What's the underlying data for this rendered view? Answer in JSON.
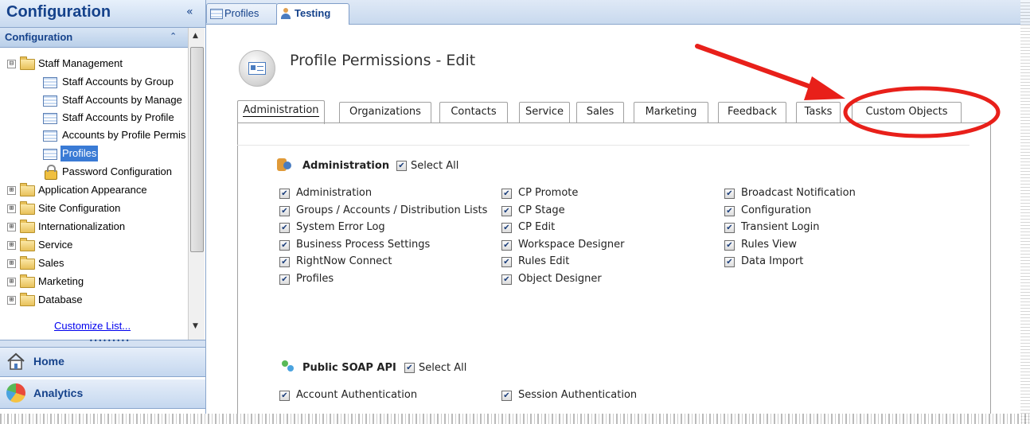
{
  "nav": {
    "pane_title": "Configuration",
    "collapse_glyph": "«",
    "section_label": "Configuration",
    "section_chevron": "⌃",
    "tree": [
      {
        "label": "Staff Management",
        "type": "folder",
        "expander": "⊟"
      },
      {
        "label": "Staff Accounts by Group",
        "type": "report"
      },
      {
        "label": "Staff Accounts by Manage",
        "type": "report"
      },
      {
        "label": "Staff Accounts by Profile",
        "type": "report"
      },
      {
        "label": "Accounts by Profile Permis",
        "type": "report"
      },
      {
        "label": "Profiles",
        "type": "report",
        "selected": true
      },
      {
        "label": "Password Configuration",
        "type": "lock"
      },
      {
        "label": "Application Appearance",
        "type": "folder",
        "expander": "⊞"
      },
      {
        "label": "Site Configuration",
        "type": "folder",
        "expander": "⊞"
      },
      {
        "label": "Internationalization",
        "type": "folder",
        "expander": "⊞"
      },
      {
        "label": "Service",
        "type": "folder",
        "expander": "⊞"
      },
      {
        "label": "Sales",
        "type": "folder",
        "expander": "⊞"
      },
      {
        "label": "Marketing",
        "type": "folder",
        "expander": "⊞"
      },
      {
        "label": "Database",
        "type": "folder",
        "expander": "⊞"
      }
    ],
    "customize_link": "Customize List...",
    "splitter_dots": "•••••••••",
    "home_label": "Home",
    "analytics_label": "Analytics"
  },
  "doc_tabs": [
    {
      "label": "Profiles",
      "icon": "report-icon",
      "active": false
    },
    {
      "label": "Testing",
      "icon": "user-icon",
      "active": true
    }
  ],
  "page": {
    "title": "Profile Permissions - Edit"
  },
  "perm_tabs": [
    {
      "label": "Administration",
      "active": true
    },
    {
      "label": "Organizations"
    },
    {
      "label": "Contacts"
    },
    {
      "label": "Service"
    },
    {
      "label": "Sales"
    },
    {
      "label": "Marketing"
    },
    {
      "label": "Feedback"
    },
    {
      "label": "Tasks"
    },
    {
      "label": "Custom Objects",
      "highlighted": true
    }
  ],
  "admin_section": {
    "title": "Administration",
    "select_all": "Select All",
    "col1": [
      "Administration",
      "Groups / Accounts / Distribution Lists",
      "System Error Log",
      "Business Process Settings",
      "RightNow Connect",
      "Profiles"
    ],
    "col2": [
      "CP Promote",
      "CP Stage",
      "CP Edit",
      "Workspace Designer",
      "Rules Edit",
      "Object Designer"
    ],
    "col3": [
      "Broadcast Notification",
      "Configuration",
      "Transient Login",
      "Rules View",
      "Data Import"
    ]
  },
  "soap_section": {
    "title": "Public SOAP API",
    "select_all": "Select All",
    "items": [
      "Account Authentication",
      "Session Authentication"
    ]
  },
  "check_glyph": "✔",
  "colors": {
    "annotation_red": "#e8201a",
    "header_blue": "#15428b"
  }
}
